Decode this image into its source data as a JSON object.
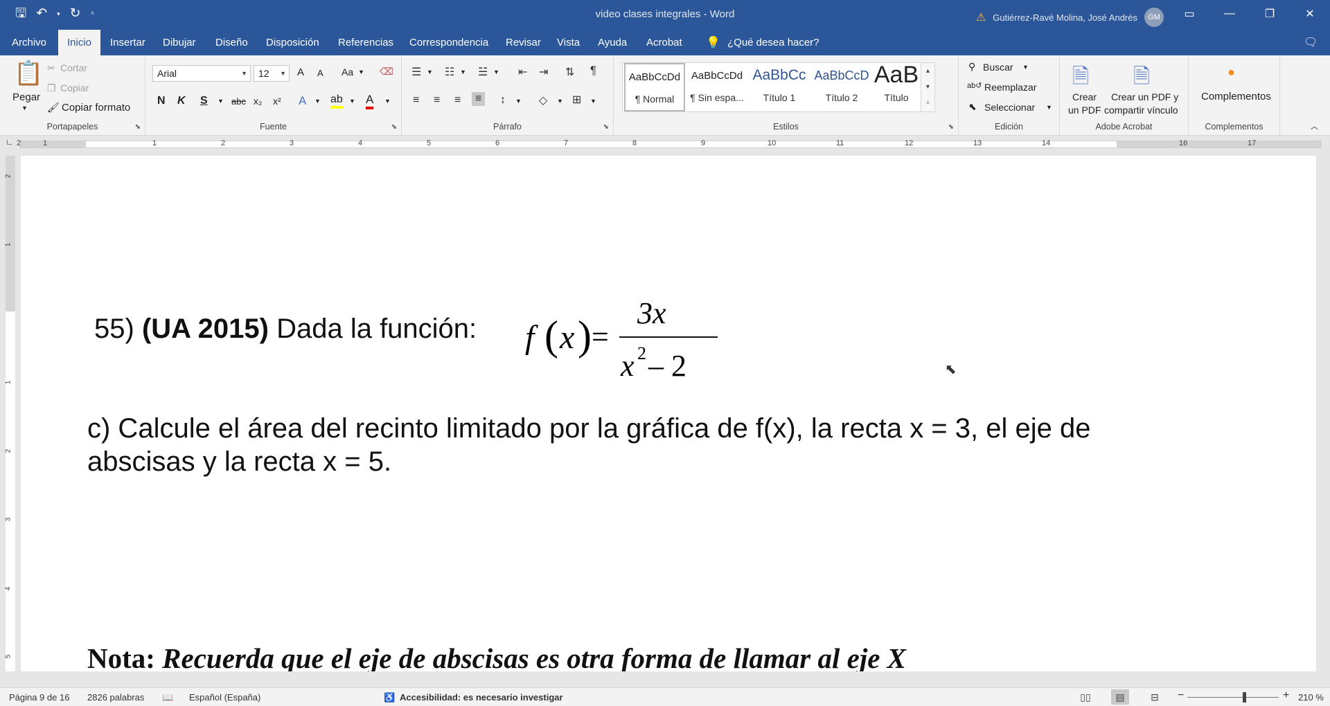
{
  "window": {
    "title": "video clases integrales  -  Word",
    "user": "Gutiérrez-Ravé Molina, José Andrés",
    "avatar": "GM",
    "qat": [
      "save-icon",
      "undo-icon",
      "chevron-down-icon",
      "redo-icon",
      "customize-icon"
    ]
  },
  "menu": {
    "tabs": [
      "Archivo",
      "Inicio",
      "Insertar",
      "Dibujar",
      "Diseño",
      "Disposición",
      "Referencias",
      "Correspondencia",
      "Revisar",
      "Vista",
      "Ayuda",
      "Acrobat"
    ],
    "active": "Inicio",
    "search": "¿Qué desea hacer?"
  },
  "ribbon": {
    "portapapeles": {
      "label": "Portapapeles",
      "pegar": "Pegar",
      "cortar": "Cortar",
      "copiar": "Copiar",
      "copiar_formato": "Copiar formato"
    },
    "fuente": {
      "label": "Fuente",
      "font": "Arial",
      "size": "12",
      "n": "N",
      "k": "K",
      "s": "S",
      "abc": "abc",
      "sub": "x₂",
      "sup": "x²",
      "aa": "Aa",
      "grow": "A",
      "shrink": "A"
    },
    "parrafo": {
      "label": "Párrafo"
    },
    "estilos": {
      "label": "Estilos",
      "items": [
        {
          "preview": "AaBbCcDd",
          "name": "¶ Normal"
        },
        {
          "preview": "AaBbCcDd",
          "name": "¶ Sin espa..."
        },
        {
          "preview": "AaBbCc",
          "name": "Título 1"
        },
        {
          "preview": "AaBbCcD",
          "name": "Título 2"
        },
        {
          "preview": "AaB",
          "name": "Título"
        }
      ]
    },
    "edicion": {
      "label": "Edición",
      "buscar": "Buscar",
      "reemplazar": "Reemplazar",
      "seleccionar": "Seleccionar"
    },
    "acrobat": {
      "label": "Adobe Acrobat",
      "crear1": "Crear",
      "crear2": "un PDF",
      "compartir1": "Crear un PDF y",
      "compartir2": "compartir vínculo"
    },
    "complementos": {
      "label": "Complementos",
      "button": "Complementos"
    }
  },
  "ruler": {
    "numbers": [
      "2",
      "1",
      "1",
      "2",
      "3",
      "4",
      "5",
      "6",
      "7",
      "8",
      "9",
      "10",
      "11",
      "12",
      "13",
      "14",
      "16",
      "17"
    ]
  },
  "vruler": {
    "numbers": [
      "2",
      "1",
      "1",
      "2",
      "3",
      "4",
      "5"
    ]
  },
  "document": {
    "p1_num": "55) ",
    "p1_bold": "(UA 2015)",
    "p1_rest": " Dada la función:",
    "formula": {
      "f": "f",
      "x": "x",
      "num": "3x",
      "den_x": "x",
      "den_exp": "2",
      "den_rest": " – 2",
      "eq": "="
    },
    "p2": "c) Calcule el área del recinto limitado por la gráfica de f(x), la recta x = 3, el eje de abscisas y la recta x = 5.",
    "nota_bold": "Nota:",
    "nota_italic": " Recuerda que el eje de abscisas es otra forma de llamar al eje X"
  },
  "status": {
    "page": "Página 9 de 16",
    "words": "2826 palabras",
    "language": "Español (España)",
    "accessibility": "Accesibilidad: es necesario investigar",
    "zoom": "210 %"
  }
}
